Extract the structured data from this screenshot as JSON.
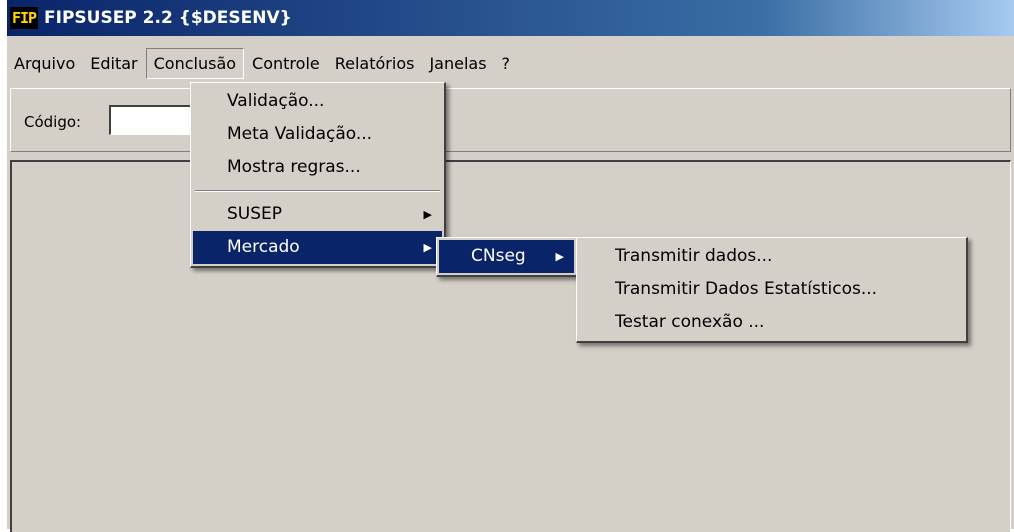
{
  "window": {
    "logo_text": "FIP",
    "title": "FIPSUSEP 2.2 {$DESENV}"
  },
  "menubar": {
    "items": [
      "Arquivo",
      "Editar",
      "Conclusão",
      "Controle",
      "Relatórios",
      "Janelas",
      "?"
    ]
  },
  "toolbar": {
    "code_label": "Código:",
    "code_value": ""
  },
  "menu_conclusao": {
    "items": [
      "Validação...",
      "Meta Validação...",
      "Mostra regras...",
      "SUSEP",
      "Mercado"
    ],
    "submenu_arrow": "▶"
  },
  "menu_mercado": {
    "items": [
      "CNseg"
    ]
  },
  "menu_cnseg": {
    "items": [
      "Transmitir dados...",
      "Transmitir Dados Estatísticos...",
      "Testar conexão ..."
    ]
  },
  "colors": {
    "highlight": "#0a246a",
    "face": "#d4d0c8"
  }
}
